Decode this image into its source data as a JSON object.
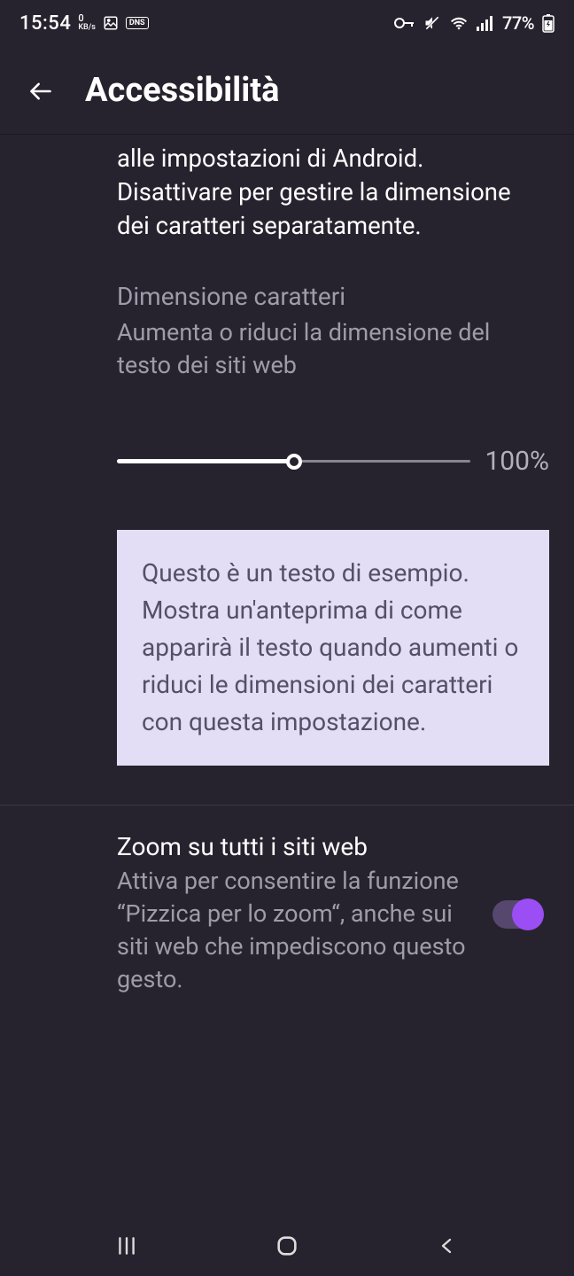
{
  "status": {
    "time": "15:54",
    "kb_top": "0",
    "kb_bottom": "KB/s",
    "dns": "DNS",
    "battery": "77%"
  },
  "header": {
    "title": "Accessibilità"
  },
  "partial_desc": "alle impostazioni di Android. Disattivare per gestire la dimensione dei caratteri separatamente.",
  "font_size": {
    "title": "Dimensione caratteri",
    "desc": "Aumenta o riduci la dimensione del testo dei siti web",
    "value": "100%"
  },
  "sample_text": "Questo è un testo di esempio. Mostra un'anteprima di come apparirà il testo quando aumenti o riduci le dimensioni dei caratteri con questa impostazione.",
  "zoom": {
    "title": "Zoom su tutti i siti web",
    "desc": "Attiva per consentire la funzione “Pizzica per lo zoom“, anche sui siti web che impediscono questo gesto."
  }
}
